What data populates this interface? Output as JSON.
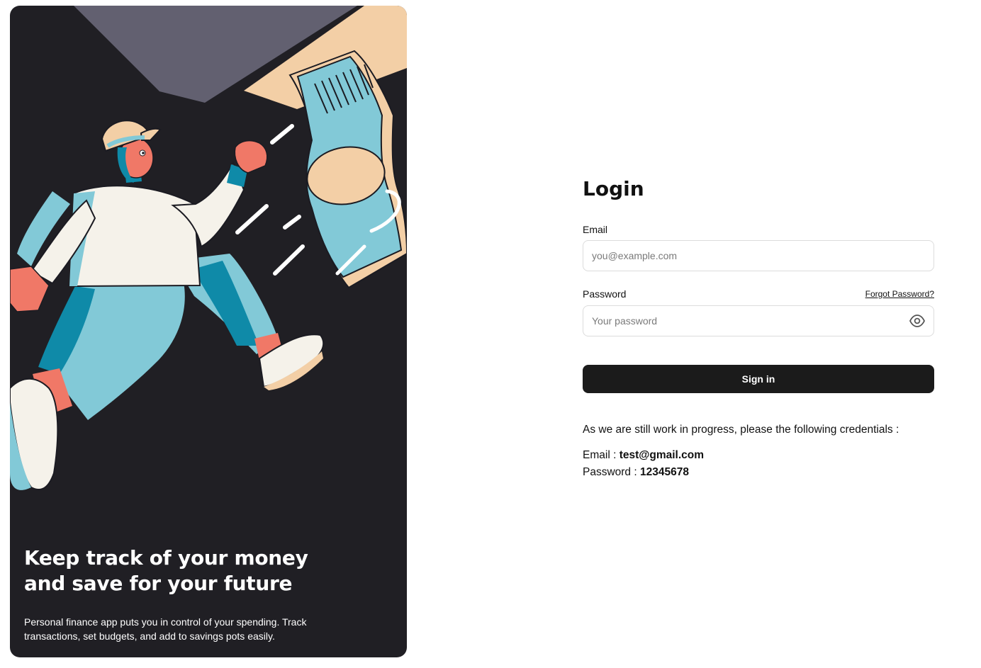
{
  "hero": {
    "title_line1": "Keep track of your money",
    "title_line2": "and save for your future",
    "description": "Personal finance app puts you in control of your spending. Track transactions, set budgets, and add to savings pots easily.",
    "illustration": "person-chasing-money-illustration"
  },
  "login": {
    "title": "Login",
    "email": {
      "label": "Email",
      "placeholder": "you@example.com",
      "value": ""
    },
    "password": {
      "label": "Password",
      "placeholder": "Your password",
      "value": "",
      "forgot_label": "Forgot Password?",
      "toggle_icon": "eye-icon"
    },
    "submit_label": "Sign in"
  },
  "notice": {
    "message": "As we are still work in progress, please the following credentials :",
    "email_label": "Email :",
    "email_value": "test@gmail.com",
    "password_label": "Password :",
    "password_value": "12345678"
  },
  "colors": {
    "hero_background": "#201f24",
    "button_background": "#1b1b1b",
    "accent_blue": "#82c9d7",
    "accent_dark_blue": "#0f8aa8",
    "skin": "#f07867",
    "paper": "#f3cfa6",
    "purple_grey": "#626070"
  }
}
